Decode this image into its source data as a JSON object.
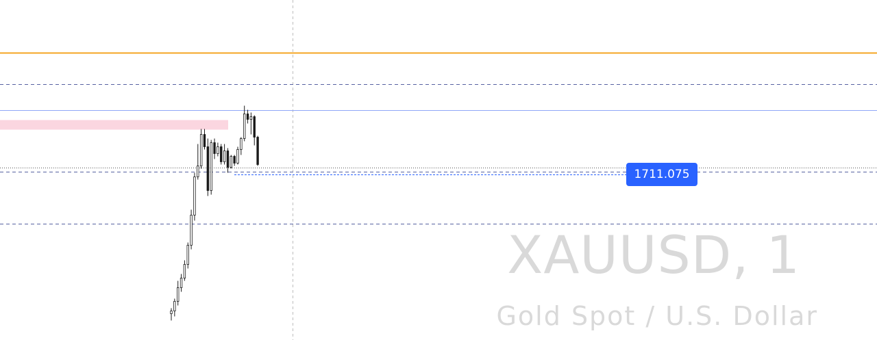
{
  "chart_data": {
    "type": "candlestick",
    "symbol": "XAUUSD, 1",
    "description": "Gold Spot / U.S. Dollar",
    "price_label": "1711.075",
    "colors": {
      "price_tag_bg": "#2962ff",
      "orange_level": "#f5a623",
      "blue_level": "#8fa7f7",
      "dashed_level": "#5560a0",
      "zone": "#fbd6e0",
      "crosshair": "#bdbdbd",
      "candle": "#1a1a1a",
      "watermark": "#d9d9d9"
    },
    "levels": [
      {
        "kind": "solid-orange",
        "price": 1719.5
      },
      {
        "kind": "dashed",
        "price": 1717.2
      },
      {
        "kind": "solid-blue",
        "price": 1715.3
      },
      {
        "kind": "dotted-current",
        "price": 1711.075
      },
      {
        "kind": "dashed",
        "price": 1710.8
      },
      {
        "kind": "dashed",
        "price": 1707.0
      }
    ],
    "zone": {
      "top": 1714.55,
      "bottom": 1713.85
    },
    "candles": [
      [
        1700.4,
        1700.8,
        1699.9,
        1700.6
      ],
      [
        1700.6,
        1701.5,
        1700.2,
        1701.3
      ],
      [
        1701.3,
        1702.8,
        1701.0,
        1702.3
      ],
      [
        1702.3,
        1703.3,
        1702.0,
        1703.0
      ],
      [
        1703.0,
        1704.3,
        1702.8,
        1704.0
      ],
      [
        1704.0,
        1705.6,
        1703.7,
        1705.4
      ],
      [
        1705.4,
        1708.0,
        1705.1,
        1707.6
      ],
      [
        1707.6,
        1710.7,
        1707.2,
        1710.4
      ],
      [
        1710.4,
        1712.8,
        1710.2,
        1711.2
      ],
      [
        1711.2,
        1713.9,
        1711.0,
        1713.5
      ],
      [
        1713.5,
        1713.9,
        1712.4,
        1712.6
      ],
      [
        1712.6,
        1713.2,
        1709.0,
        1709.4
      ],
      [
        1709.4,
        1713.1,
        1709.1,
        1712.9
      ],
      [
        1712.9,
        1713.2,
        1711.7,
        1712.1
      ],
      [
        1712.1,
        1712.9,
        1711.9,
        1712.6
      ],
      [
        1712.6,
        1712.8,
        1711.3,
        1711.5
      ],
      [
        1711.5,
        1712.8,
        1711.3,
        1712.3
      ],
      [
        1712.3,
        1712.5,
        1710.7,
        1711.1
      ],
      [
        1711.1,
        1712.0,
        1711.0,
        1711.9
      ],
      [
        1711.9,
        1712.0,
        1711.2,
        1711.4
      ],
      [
        1711.4,
        1712.6,
        1711.3,
        1712.4
      ],
      [
        1712.4,
        1713.3,
        1712.0,
        1713.2
      ],
      [
        1713.2,
        1715.6,
        1713.0,
        1715.0
      ],
      [
        1715.0,
        1715.3,
        1714.3,
        1714.6
      ],
      [
        1714.6,
        1715.1,
        1713.5,
        1714.8
      ],
      [
        1714.8,
        1714.9,
        1712.7,
        1713.3
      ],
      [
        1713.3,
        1713.4,
        1711.2,
        1711.3
      ]
    ]
  }
}
